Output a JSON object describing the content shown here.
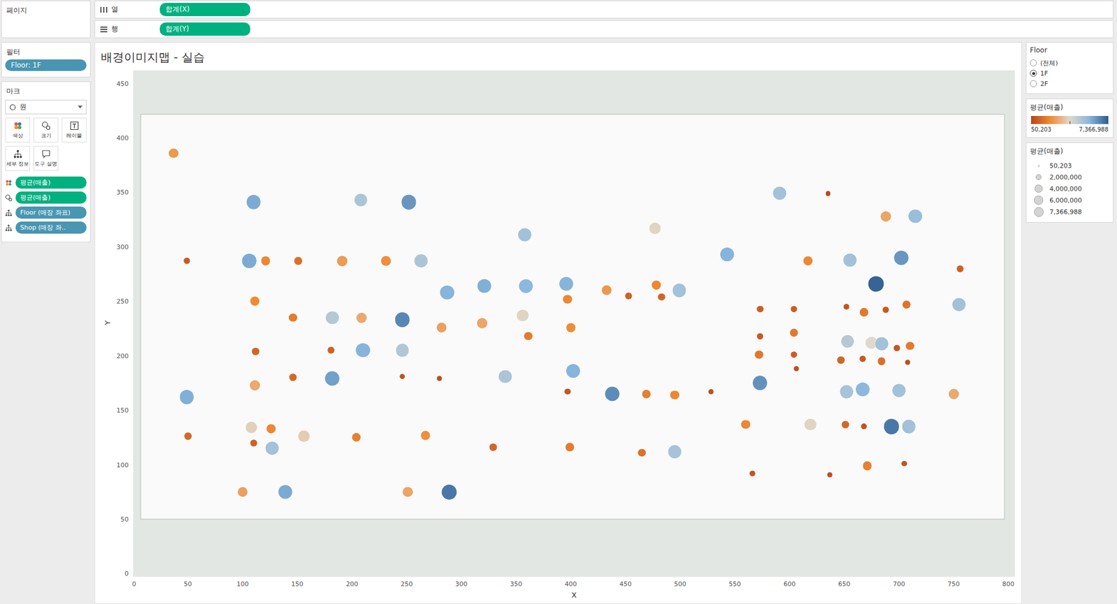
{
  "shelves": {
    "pages": "페이지",
    "columns": {
      "label": "열",
      "pill": "합계(X)"
    },
    "rows": {
      "label": "행",
      "pill": "합계(Y)"
    }
  },
  "filters": {
    "title": "필터",
    "pills": [
      "Floor: 1F"
    ]
  },
  "marks": {
    "title": "마크",
    "type": "원",
    "buttons": [
      "색상",
      "크기",
      "레이블",
      "세부 정보",
      "도구 설명"
    ],
    "fields": [
      {
        "label": "평균(매출)",
        "kind": "measure",
        "role": "color"
      },
      {
        "label": "평균(매출)",
        "kind": "measure",
        "role": "size"
      },
      {
        "label": "Floor (매장 좌표)",
        "kind": "dimension",
        "role": "detail"
      },
      {
        "label": "Shop (매장 좌..",
        "kind": "dimension",
        "role": "detail"
      }
    ]
  },
  "view": {
    "title": "배경이미지맵 - 실습",
    "x_label": "X",
    "y_label": "Y",
    "x_ticks": [
      "0",
      "50",
      "100",
      "150",
      "200",
      "250",
      "300",
      "350",
      "400",
      "450",
      "500",
      "550",
      "600",
      "650",
      "700",
      "750",
      "800"
    ],
    "y_ticks": [
      "0",
      "50",
      "100",
      "150",
      "200",
      "250",
      "300",
      "350",
      "400",
      "450"
    ],
    "points": [
      {
        "x": 37,
        "y": 386,
        "value": 2200000
      },
      {
        "x": 110,
        "y": 341,
        "value": 5800000
      },
      {
        "x": 208,
        "y": 343,
        "value": 4800000
      },
      {
        "x": 252,
        "y": 341,
        "value": 6200000
      },
      {
        "x": 358,
        "y": 311,
        "value": 5000000
      },
      {
        "x": 477,
        "y": 317,
        "value": 3600000
      },
      {
        "x": 591,
        "y": 349,
        "value": 5000000
      },
      {
        "x": 635,
        "y": 349,
        "value": 200000
      },
      {
        "x": 688,
        "y": 328,
        "value": 2500000
      },
      {
        "x": 715,
        "y": 328,
        "value": 5200000
      },
      {
        "x": 49,
        "y": 287,
        "value": 600000
      },
      {
        "x": 106,
        "y": 287,
        "value": 5800000
      },
      {
        "x": 121,
        "y": 287,
        "value": 1800000
      },
      {
        "x": 151,
        "y": 287,
        "value": 1200000
      },
      {
        "x": 191,
        "y": 287,
        "value": 2300000
      },
      {
        "x": 231,
        "y": 287,
        "value": 2000000
      },
      {
        "x": 263,
        "y": 287,
        "value": 4800000
      },
      {
        "x": 543,
        "y": 293,
        "value": 5600000
      },
      {
        "x": 617,
        "y": 287,
        "value": 1800000
      },
      {
        "x": 655,
        "y": 288,
        "value": 5000000
      },
      {
        "x": 702,
        "y": 290,
        "value": 6200000
      },
      {
        "x": 756,
        "y": 280,
        "value": 800000
      },
      {
        "x": 287,
        "y": 258,
        "value": 5600000
      },
      {
        "x": 321,
        "y": 264,
        "value": 5700000
      },
      {
        "x": 359,
        "y": 264,
        "value": 5500000
      },
      {
        "x": 396,
        "y": 266,
        "value": 5600000
      },
      {
        "x": 397,
        "y": 252,
        "value": 1800000
      },
      {
        "x": 433,
        "y": 260,
        "value": 2200000
      },
      {
        "x": 453,
        "y": 255,
        "value": 800000
      },
      {
        "x": 478,
        "y": 265,
        "value": 1800000
      },
      {
        "x": 483,
        "y": 254,
        "value": 900000
      },
      {
        "x": 499,
        "y": 260,
        "value": 5000000
      },
      {
        "x": 679,
        "y": 266,
        "value": 7200000
      },
      {
        "x": 111,
        "y": 250,
        "value": 1900000
      },
      {
        "x": 146,
        "y": 235,
        "value": 1500000
      },
      {
        "x": 182,
        "y": 235,
        "value": 4600000
      },
      {
        "x": 209,
        "y": 235,
        "value": 2600000
      },
      {
        "x": 246,
        "y": 233,
        "value": 6500000
      },
      {
        "x": 282,
        "y": 226,
        "value": 2400000
      },
      {
        "x": 319,
        "y": 230,
        "value": 2500000
      },
      {
        "x": 356,
        "y": 237,
        "value": 3600000
      },
      {
        "x": 361,
        "y": 218,
        "value": 1500000
      },
      {
        "x": 400,
        "y": 226,
        "value": 1900000
      },
      {
        "x": 573,
        "y": 243,
        "value": 700000
      },
      {
        "x": 604,
        "y": 243,
        "value": 700000
      },
      {
        "x": 652,
        "y": 245,
        "value": 500000
      },
      {
        "x": 668,
        "y": 240,
        "value": 1400000
      },
      {
        "x": 688,
        "y": 242,
        "value": 600000
      },
      {
        "x": 707,
        "y": 247,
        "value": 1300000
      },
      {
        "x": 755,
        "y": 247,
        "value": 5000000
      },
      {
        "x": 573,
        "y": 218,
        "value": 600000
      },
      {
        "x": 604,
        "y": 221,
        "value": 1400000
      },
      {
        "x": 653,
        "y": 213,
        "value": 4600000
      },
      {
        "x": 675,
        "y": 212,
        "value": 3700000
      },
      {
        "x": 684,
        "y": 211,
        "value": 5000000
      },
      {
        "x": 710,
        "y": 209,
        "value": 1500000
      },
      {
        "x": 698,
        "y": 207,
        "value": 500000
      },
      {
        "x": 112,
        "y": 204,
        "value": 900000
      },
      {
        "x": 181,
        "y": 205,
        "value": 800000
      },
      {
        "x": 210,
        "y": 205,
        "value": 5600000
      },
      {
        "x": 246,
        "y": 205,
        "value": 4700000
      },
      {
        "x": 572,
        "y": 201,
        "value": 1400000
      },
      {
        "x": 604,
        "y": 201,
        "value": 700000
      },
      {
        "x": 647,
        "y": 196,
        "value": 900000
      },
      {
        "x": 667,
        "y": 197,
        "value": 600000
      },
      {
        "x": 684,
        "y": 195,
        "value": 1200000
      },
      {
        "x": 708,
        "y": 194,
        "value": 300000
      },
      {
        "x": 111,
        "y": 173,
        "value": 2600000
      },
      {
        "x": 146,
        "y": 180,
        "value": 1000000
      },
      {
        "x": 182,
        "y": 179,
        "value": 6000000
      },
      {
        "x": 246,
        "y": 181,
        "value": 400000
      },
      {
        "x": 280,
        "y": 179,
        "value": 300000
      },
      {
        "x": 340,
        "y": 181,
        "value": 4800000
      },
      {
        "x": 402,
        "y": 186,
        "value": 5600000
      },
      {
        "x": 573,
        "y": 175,
        "value": 6300000
      },
      {
        "x": 606,
        "y": 188,
        "value": 300000
      },
      {
        "x": 49,
        "y": 162,
        "value": 5700000
      },
      {
        "x": 397,
        "y": 167,
        "value": 500000
      },
      {
        "x": 438,
        "y": 165,
        "value": 6400000
      },
      {
        "x": 469,
        "y": 165,
        "value": 1600000
      },
      {
        "x": 495,
        "y": 164,
        "value": 1800000
      },
      {
        "x": 528,
        "y": 167,
        "value": 300000
      },
      {
        "x": 652,
        "y": 167,
        "value": 4900000
      },
      {
        "x": 667,
        "y": 169,
        "value": 5500000
      },
      {
        "x": 700,
        "y": 168,
        "value": 5000000
      },
      {
        "x": 750,
        "y": 165,
        "value": 2600000
      },
      {
        "x": 108,
        "y": 134,
        "value": 3500000
      },
      {
        "x": 126,
        "y": 133,
        "value": 1800000
      },
      {
        "x": 110,
        "y": 120,
        "value": 800000
      },
      {
        "x": 127,
        "y": 115,
        "value": 5000000
      },
      {
        "x": 156,
        "y": 126,
        "value": 3400000
      },
      {
        "x": 204,
        "y": 125,
        "value": 1600000
      },
      {
        "x": 267,
        "y": 127,
        "value": 2000000
      },
      {
        "x": 50,
        "y": 126,
        "value": 1000000
      },
      {
        "x": 560,
        "y": 137,
        "value": 1800000
      },
      {
        "x": 619,
        "y": 137,
        "value": 3600000
      },
      {
        "x": 651,
        "y": 137,
        "value": 1000000
      },
      {
        "x": 668,
        "y": 135,
        "value": 400000
      },
      {
        "x": 693,
        "y": 135,
        "value": 6800000
      },
      {
        "x": 709,
        "y": 135,
        "value": 5000000
      },
      {
        "x": 329,
        "y": 116,
        "value": 900000
      },
      {
        "x": 399,
        "y": 116,
        "value": 1500000
      },
      {
        "x": 465,
        "y": 111,
        "value": 1200000
      },
      {
        "x": 495,
        "y": 112,
        "value": 4900000
      },
      {
        "x": 566,
        "y": 92,
        "value": 500000
      },
      {
        "x": 637,
        "y": 91,
        "value": 300000
      },
      {
        "x": 671,
        "y": 99,
        "value": 1600000
      },
      {
        "x": 705,
        "y": 101,
        "value": 400000
      },
      {
        "x": 100,
        "y": 75,
        "value": 2400000
      },
      {
        "x": 139,
        "y": 75,
        "value": 5800000
      },
      {
        "x": 251,
        "y": 75,
        "value": 2500000
      },
      {
        "x": 289,
        "y": 75,
        "value": 6800000
      }
    ]
  },
  "floor_filter": {
    "title": "Floor",
    "options": [
      {
        "label": "(전체)",
        "selected": false
      },
      {
        "label": "1F",
        "selected": true
      },
      {
        "label": "2F",
        "selected": false
      }
    ]
  },
  "color_legend": {
    "title": "평균(매출)",
    "min": "50,203",
    "max": "7,366,988",
    "min_value": 50203,
    "max_value": 7366988
  },
  "size_legend": {
    "title": "평균(매출)",
    "items": [
      {
        "label": "50,203",
        "value": 50203
      },
      {
        "label": "2,000,000",
        "value": 2000000
      },
      {
        "label": "4,000,000",
        "value": 4000000
      },
      {
        "label": "6,000,000",
        "value": 6000000
      },
      {
        "label": "7,366,988",
        "value": 7366988
      }
    ]
  }
}
